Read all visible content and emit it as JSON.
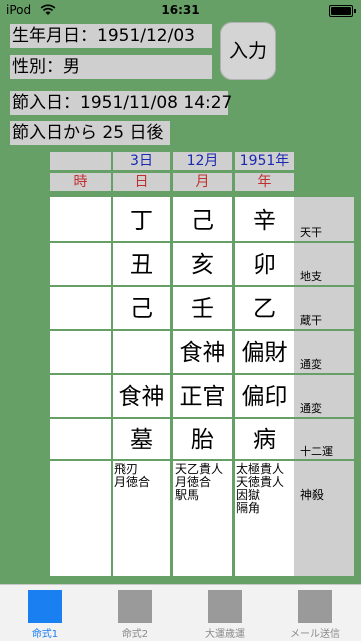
{
  "status": {
    "device": "iPod",
    "time": "16:31"
  },
  "info": {
    "birth": "生年月日：1951/12/03",
    "gender": "性別：男",
    "setsunyu": "節入日：1951/11/08 14:27",
    "after": "節入日から 25 日後"
  },
  "input_button": "入力",
  "header": {
    "values": [
      "3日",
      "12月",
      "1951年"
    ],
    "pillars": [
      "時",
      "日",
      "月",
      "年"
    ]
  },
  "rows": {
    "tenkan": {
      "label": "天干",
      "cells": [
        "",
        "丁",
        "己",
        "辛"
      ]
    },
    "chishi": {
      "label": "地支",
      "cells": [
        "",
        "丑",
        "亥",
        "卯"
      ]
    },
    "zoukan": {
      "label": "蔵干",
      "cells": [
        "",
        "己",
        "壬",
        "乙"
      ]
    },
    "tsuhen1": {
      "label": "通変",
      "cells": [
        "",
        "",
        "食神",
        "偏財"
      ]
    },
    "tsuhen2": {
      "label": "通変",
      "cells": [
        "",
        "食神",
        "正官",
        "偏印"
      ]
    },
    "juuni": {
      "label": "十二運",
      "cells": [
        "",
        "墓",
        "胎",
        "病"
      ]
    },
    "shinsatsu": {
      "label": "神殺",
      "cells": [
        "",
        "飛刃\n月徳合",
        "天乙貴人\n月徳合\n駅馬",
        "太極貴人\n天徳貴人\n因獄\n隔角"
      ]
    }
  },
  "tabs": [
    {
      "label": "命式1",
      "active": true
    },
    {
      "label": "命式2",
      "active": false
    },
    {
      "label": "大運歳運",
      "active": false
    },
    {
      "label": "メール送信",
      "active": false
    }
  ],
  "colors": {
    "background": "#66a066",
    "panel": "#cfcfcf",
    "accent": "#1a7ff0",
    "blue_text": "#1a2ab0",
    "red_text": "#c03030"
  }
}
